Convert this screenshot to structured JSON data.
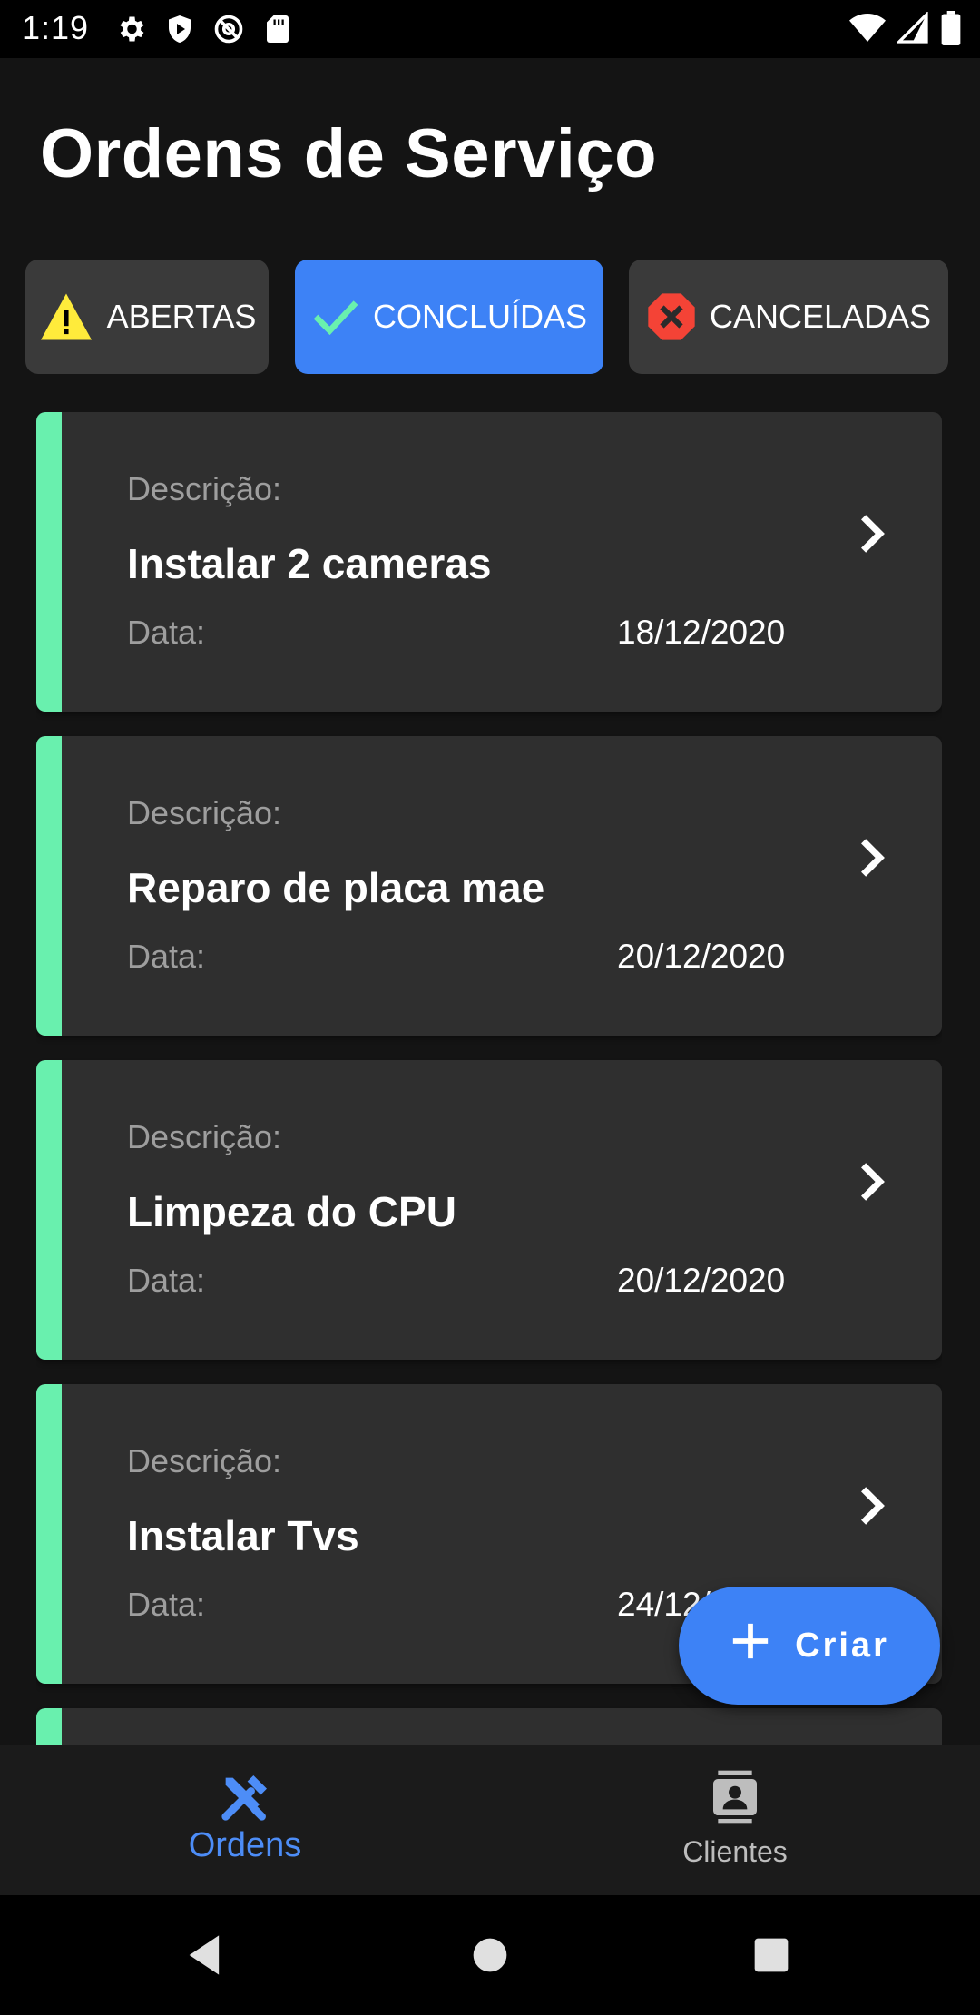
{
  "status_bar": {
    "time": "1:19"
  },
  "page": {
    "title": "Ordens de Serviço"
  },
  "filters": [
    {
      "label": "ABERTAS",
      "icon": "warning-icon",
      "active": false
    },
    {
      "label": "CONCLUÍDAS",
      "icon": "check-icon",
      "active": true
    },
    {
      "label": "CANCELADAS",
      "icon": "cancel-icon",
      "active": false
    }
  ],
  "orders": [
    {
      "desc_label": "Descrição:",
      "description": "Instalar 2 cameras",
      "date_label": "Data:",
      "date": "18/12/2020"
    },
    {
      "desc_label": "Descrição:",
      "description": "Reparo de placa mae",
      "date_label": "Data:",
      "date": "20/12/2020"
    },
    {
      "desc_label": "Descrição:",
      "description": "Limpeza do CPU",
      "date_label": "Data:",
      "date": "20/12/2020"
    },
    {
      "desc_label": "Descrição:",
      "description": "Instalar Tvs",
      "date_label": "Data:",
      "date": "24/12/2020"
    }
  ],
  "fab": {
    "label": "Criar"
  },
  "bottom_nav": {
    "items": [
      {
        "label": "Ordens",
        "icon": "tools-icon",
        "active": true
      },
      {
        "label": "Clientes",
        "icon": "contacts-icon",
        "active": false
      }
    ]
  },
  "colors": {
    "accent": "#3d82f6",
    "status_green": "#69f0ae",
    "card_bg": "#2f2f2f",
    "background": "#141414"
  }
}
